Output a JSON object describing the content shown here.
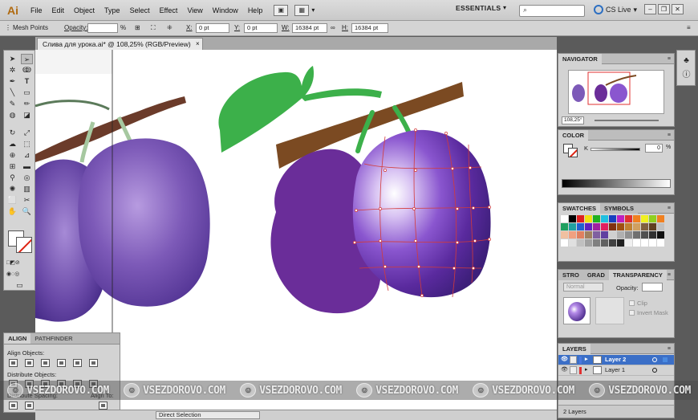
{
  "app": {
    "logo": "Ai",
    "menu": [
      "File",
      "Edit",
      "Object",
      "Type",
      "Select",
      "Effect",
      "View",
      "Window",
      "Help"
    ],
    "workspace": "ESSENTIALS",
    "search_placeholder": "",
    "cs_live": "CS Live",
    "window_controls": [
      "minimize-icon",
      "restore-icon",
      "close-icon"
    ]
  },
  "control_bar": {
    "mode": "Mesh Points",
    "opacity_label": "Opacity:",
    "opacity_value": "",
    "opacity_unit": "%",
    "x_label": "X:",
    "x_value": "0 pt",
    "y_label": "Y:",
    "y_value": "0 pt",
    "w_label": "W:",
    "w_value": "16384 pt",
    "h_label": "H:",
    "h_value": "16384 pt"
  },
  "document": {
    "tab_title": "Слива для урока.ai* @ 108,25% (RGB/Preview)",
    "close_glyph": "×"
  },
  "align_panel": {
    "tabs": [
      "ALIGN",
      "PATHFINDER"
    ],
    "align_objects_label": "Align Objects:",
    "distribute_objects_label": "Distribute Objects:",
    "distribute_spacing_label": "Distribute Spacing:",
    "align_to_label": "Align To:"
  },
  "status_bar": {
    "tool": "Direct Selection"
  },
  "navigator": {
    "title": "NAVIGATOR",
    "zoom": "108,25°"
  },
  "color_panel": {
    "title": "COLOR",
    "channel": "K",
    "value": "0",
    "unit": "%"
  },
  "swatches_panel": {
    "tabs": [
      "SWATCHES",
      "SYMBOLS"
    ],
    "colors": [
      "#ffffff",
      "#000000",
      "#e02020",
      "#f0e010",
      "#20b020",
      "#20c0e0",
      "#1840c0",
      "#c020c0",
      "#e03030",
      "#f08020",
      "#f0f020",
      "#90d020",
      "#f08020",
      "#20a060",
      "#20a0a0",
      "#2060d0",
      "#6020c0",
      "#a020a0",
      "#e02060",
      "#803010",
      "#a05010",
      "#c08030",
      "#d0a060",
      "#806040",
      "#604020",
      "#c0c0c0",
      "#f0c0a0",
      "#f0a080",
      "#e08060",
      "#a08060",
      "#8060a0",
      "#6040a0",
      "#d0d0d0",
      "#b0b0b0",
      "#909090",
      "#707070",
      "#505050",
      "#303030",
      "#101010",
      "#ffffff",
      "#e0e0e0",
      "#c0c0c0",
      "#a0a0a0",
      "#808080",
      "#606060",
      "#404040",
      "#202020",
      "#f0f0f0",
      "#ffffff",
      "#ffffff",
      "#ffffff",
      "#ffffff"
    ]
  },
  "transparency_panel": {
    "tabs": [
      "STRO",
      "GRAD",
      "TRANSPARENCY"
    ],
    "blend_mode": "Normal",
    "opacity_label": "Opacity:",
    "clip_label": "Clip",
    "invert_mask_label": "Invert Mask"
  },
  "layers_panel": {
    "title": "LAYERS",
    "layers": [
      {
        "name": "Layer 2",
        "color": "#4a78e0",
        "selected": true
      },
      {
        "name": "Layer 1",
        "color": "#e03030",
        "selected": false
      }
    ],
    "count": "2 Layers"
  },
  "watermark": {
    "text": "VSEZDOROVO.COM",
    "repeat": 6
  },
  "colors": {
    "plum_purple": "#6a2d99",
    "leaf_green": "#3cb04a",
    "branch_brown": "#7b4a22",
    "mesh_red": "#d33a3a",
    "layer_highlight": "#3b6fc7"
  }
}
